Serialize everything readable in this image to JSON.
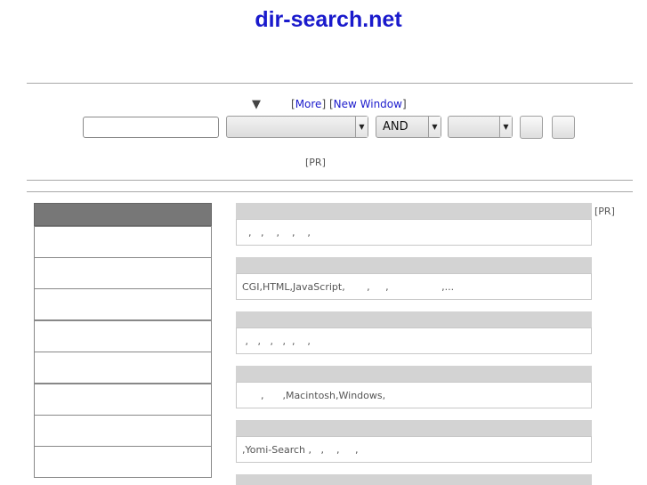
{
  "site": {
    "title": "dir-search.net"
  },
  "search": {
    "triangle": "▼",
    "more_label": "More",
    "new_window_label": "New Window",
    "input_value": "",
    "category_select_value": "",
    "operator_select_value": "AND",
    "third_select_value": "",
    "pr_label": "[PR]"
  },
  "sidebar": {
    "items": [
      "",
      "",
      "",
      "",
      "",
      "",
      "",
      ""
    ]
  },
  "categories": [
    {
      "title": "",
      "desc": "  ,   ,    ,    ,    ,"
    },
    {
      "title": "",
      "desc": "CGI,HTML,JavaScript,       ,     ,                 ,..."
    },
    {
      "title": "",
      "desc": " ,   ,   ,   ,  ,    ,"
    },
    {
      "title": "",
      "desc": "      ,      ,Macintosh,Windows,"
    },
    {
      "title": "",
      "desc": ",Yomi-Search ,   ,    ,     ,"
    }
  ],
  "main_pr": "[PR]",
  "icons": {
    "dropdown": "caret-down-icon"
  }
}
